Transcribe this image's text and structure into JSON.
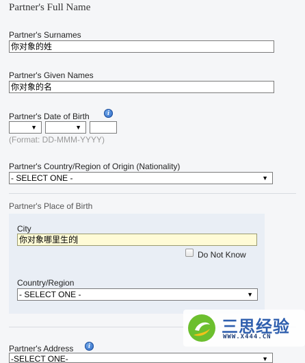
{
  "full_name_section": {
    "title": "Partner's Full Name",
    "surnames_label": "Partner's Surnames",
    "surnames_value": "你对象的姓",
    "given_names_label": "Partner's Given Names",
    "given_names_value": "你对象的名"
  },
  "dob": {
    "label": "Partner's Date of Birth",
    "day_value": "",
    "month_value": "",
    "year_value": "",
    "format_hint": "(Format: DD-MMM-YYYY)"
  },
  "nationality": {
    "label": "Partner's Country/Region of Origin (Nationality)",
    "selected": "- SELECT ONE -"
  },
  "place_of_birth": {
    "title": "Partner's Place of Birth",
    "city_label": "City",
    "city_value": "你对象哪里生的",
    "do_not_know_label": "Do Not Know",
    "country_label": "Country/Region",
    "country_selected": "- SELECT ONE -"
  },
  "address": {
    "label": "Partner's Address",
    "selected": "-SELECT ONE-"
  },
  "watermark": {
    "name": "三思经验",
    "url": "WWW.X444.CN"
  },
  "colors": {
    "panel_bg": "#e9eef5",
    "focused_input_bg": "#fffbd6",
    "info_icon": "#2a66c4",
    "watermark_green": "#6cbf2e",
    "watermark_blue": "#2f5fae"
  }
}
